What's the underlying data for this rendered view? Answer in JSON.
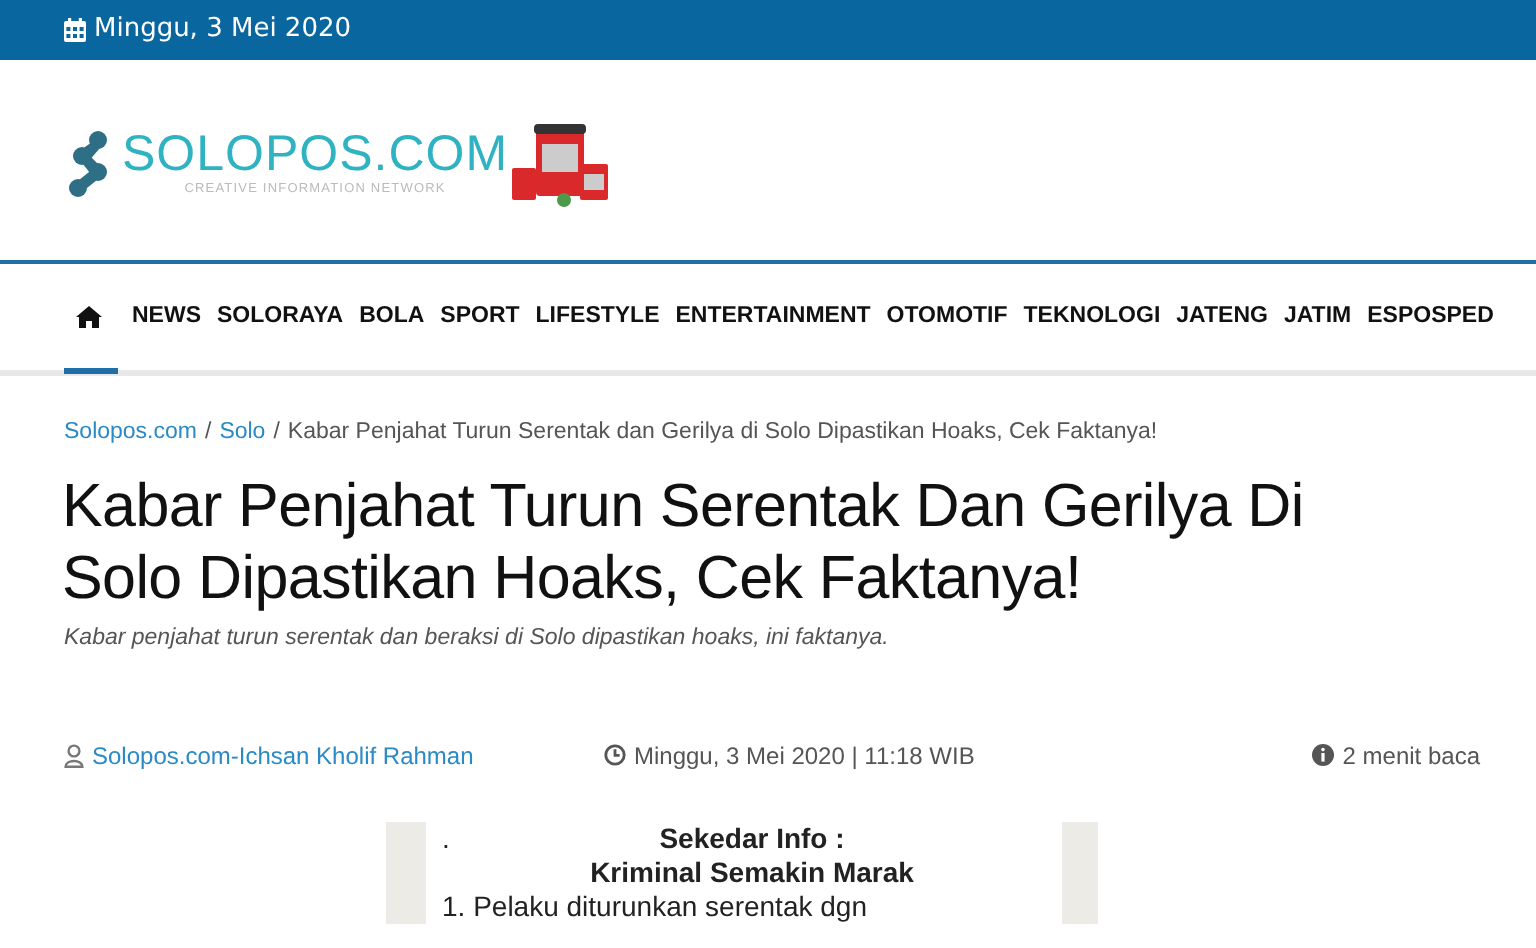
{
  "top_bar": {
    "date": "Minggu, 3 Mei 2020"
  },
  "logo": {
    "name": "SOLOPOS.COM",
    "tagline": "CREATIVE INFORMATION NETWORK"
  },
  "nav": [
    {
      "kind": "home",
      "selected": true
    },
    {
      "label": "NEWS",
      "selected": false
    },
    {
      "label": "SOLORAYA",
      "selected": false
    },
    {
      "label": "BOLA",
      "selected": false
    },
    {
      "label": "SPORT",
      "selected": false
    },
    {
      "label": "LIFESTYLE",
      "selected": false
    },
    {
      "label": "ENTERTAINMENT",
      "selected": false
    },
    {
      "label": "OTOMOTIF",
      "selected": false
    },
    {
      "label": "TEKNOLOGI",
      "selected": false
    },
    {
      "label": "JATENG",
      "selected": false
    },
    {
      "label": "JATIM",
      "selected": false
    },
    {
      "label": "ESPOSPED",
      "selected": false
    }
  ],
  "breadcrumb": {
    "separator": "/",
    "items": [
      {
        "label": "Solopos.com",
        "link": true
      },
      {
        "label": "Solo",
        "link": true
      },
      {
        "label": "Kabar Penjahat Turun Serentak dan Gerilya di Solo Dipastikan Hoaks, Cek Faktanya!",
        "link": false
      }
    ]
  },
  "article": {
    "title": "Kabar Penjahat Turun Serentak Dan Gerilya Di Solo Dipastikan Hoaks, Cek Faktanya!",
    "subtitle": "Kabar penjahat turun serentak dan beraksi di Solo dipastikan hoaks, ini faktanya.",
    "author": "Solopos.com-Ichsan Kholif Rahman",
    "published": "Minggu, 3 Mei 2020 | 11:18 WIB",
    "reading_time": "2 menit baca"
  },
  "chat_image": {
    "dot": ".",
    "lines": [
      "Sekedar Info :",
      "Kriminal Semakin Marak",
      "1. Pelaku diturunkan serentak dgn"
    ]
  }
}
